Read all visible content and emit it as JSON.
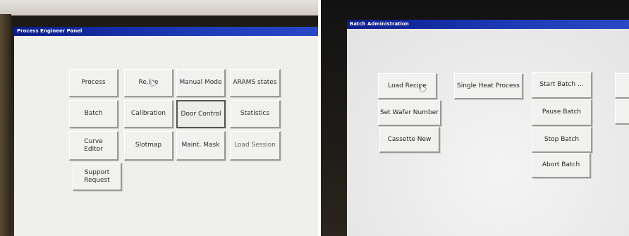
{
  "left_panel": {
    "title": "Process Engineer Panel",
    "buttons": [
      {
        "label": "Process"
      },
      {
        "label": "Re.ipe"
      },
      {
        "label": "Manual Mode"
      },
      {
        "label": "ARAMS states"
      },
      {
        "label": "Batch"
      },
      {
        "label": "Calibration"
      },
      {
        "label": "Door Control"
      },
      {
        "label": "Statistics"
      },
      {
        "label": "Curve\nEditor"
      },
      {
        "label": "Slotmap"
      },
      {
        "label": "Maint. Mask"
      },
      {
        "label": "Load Session"
      },
      {
        "label": "Support\nRequest"
      }
    ]
  },
  "right_panel": {
    "title": "Batch Administration",
    "buttons": [
      {
        "label": "Load Recipe"
      },
      {
        "label": "Single Heat Process"
      },
      {
        "label": "Start Batch ..."
      },
      {
        "label": "Set Wafer Number"
      },
      {
        "label": "Pause Batch"
      },
      {
        "label": "Cassette New"
      },
      {
        "label": "Stop Batch"
      },
      {
        "label": "Abort Batch"
      }
    ]
  },
  "colors": {
    "titlebar": "#1e3bb8",
    "button_face": "#f1f1ef",
    "screen": "#efefec"
  }
}
